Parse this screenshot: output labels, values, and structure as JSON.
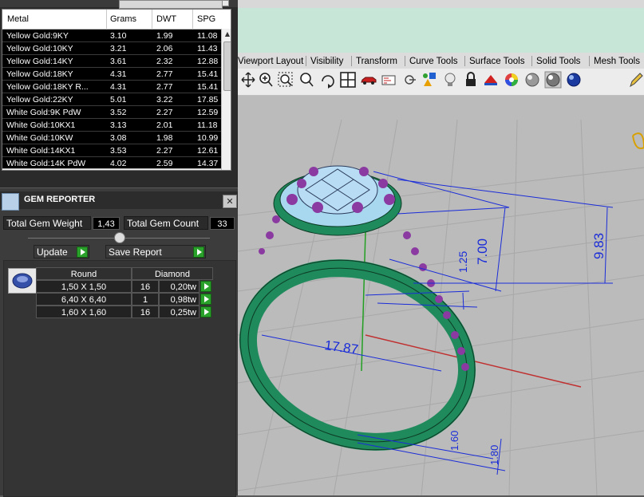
{
  "metal_table": {
    "headers": {
      "metal": "Metal",
      "grams": "Grams",
      "dwt": "DWT",
      "spg": "SPG"
    },
    "rows": [
      {
        "metal": "Yellow Gold:9KY",
        "grams": "3.10",
        "dwt": "1.99",
        "spg": "11.08"
      },
      {
        "metal": "Yellow Gold:10KY",
        "grams": "3.21",
        "dwt": "2.06",
        "spg": "11.43"
      },
      {
        "metal": "Yellow Gold:14KY",
        "grams": "3.61",
        "dwt": "2.32",
        "spg": "12.88"
      },
      {
        "metal": "Yellow Gold:18KY",
        "grams": "4.31",
        "dwt": "2.77",
        "spg": "15.41"
      },
      {
        "metal": "Yellow Gold:18KY R...",
        "grams": "4.31",
        "dwt": "2.77",
        "spg": "15.41"
      },
      {
        "metal": "Yellow Gold:22KY",
        "grams": "5.01",
        "dwt": "3.22",
        "spg": "17.85"
      },
      {
        "metal": "White Gold:9K PdW",
        "grams": "3.52",
        "dwt": "2.27",
        "spg": "12.59"
      },
      {
        "metal": "White Gold:10KX1",
        "grams": "3.13",
        "dwt": "2.01",
        "spg": "11.18"
      },
      {
        "metal": "White Gold:10KW",
        "grams": "3.08",
        "dwt": "1.98",
        "spg": "10.99"
      },
      {
        "metal": "White Gold:14KX1",
        "grams": "3.53",
        "dwt": "2.27",
        "spg": "12.61"
      },
      {
        "metal": "White Gold:14K PdW",
        "grams": "4.02",
        "dwt": "2.59",
        "spg": "14.37"
      }
    ]
  },
  "gem_reporter": {
    "title": "GEM REPORTER",
    "total_weight_label": "Total Gem Weight",
    "total_weight": "1,43",
    "total_count_label": "Total Gem Count",
    "total_count": "33",
    "update_label": "Update",
    "save_report_label": "Save Report",
    "table_header": {
      "shape": "Round",
      "type": "Diamond"
    },
    "gems": [
      {
        "size": "1,50 X 1,50",
        "count": "16",
        "weight": "0,20tw"
      },
      {
        "size": "6,40 X 6,40",
        "count": "1",
        "weight": "0,98tw"
      },
      {
        "size": "1,60 X 1,60",
        "count": "16",
        "weight": "0,25tw"
      }
    ]
  },
  "tabs": [
    "Viewport Layout",
    "Visibility",
    "Transform",
    "Curve Tools",
    "Surface Tools",
    "Solid Tools",
    "Mesh Tools"
  ],
  "toolbar_icons": [
    "move-view-icon",
    "zoom-in-icon",
    "zoom-window-icon",
    "zoom-extents-icon",
    "rotate-view-icon",
    "four-viewports-icon",
    "car-icon",
    "properties-icon",
    "point-icon",
    "shapes-icon",
    "light-bulb-icon",
    "lock-icon",
    "render-icon",
    "color-wheel-icon",
    "sphere-gray-icon",
    "sphere-shaded-icon",
    "sphere-blue-icon",
    "pen-icon"
  ],
  "dimensions": {
    "ring_diameter": "17.87",
    "head_height": "7.00",
    "total_height": "9.83",
    "small_height": "1.25",
    "band_width_a": "1.60",
    "band_width_b": "1.80"
  },
  "colors": {
    "ring": "#1f8a5c",
    "gems": "#a8d8f0",
    "prongs": "#8a3aa0",
    "dimension": "#1a2cd8",
    "viewport_bg": "#bbbbbb"
  }
}
